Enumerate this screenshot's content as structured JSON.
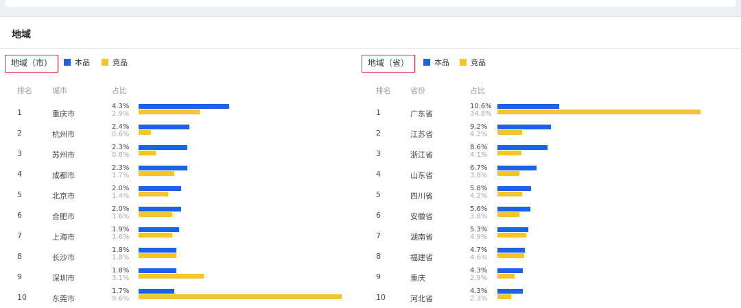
{
  "section_title": "地域",
  "colors": {
    "self": "#1a62e8",
    "comp": "#f5c623",
    "highlight_border": "#e02020"
  },
  "legend": {
    "self": "本品",
    "comp": "竞品"
  },
  "panels": {
    "city": {
      "dim_label": "地域（市）",
      "headers": {
        "rank": "排名",
        "name": "城市",
        "share": "占比"
      },
      "rows": [
        {
          "rank": "1",
          "name": "重庆市",
          "self_pct": "4.3%",
          "comp_pct": "2.9%",
          "self": 4.3,
          "comp": 2.9
        },
        {
          "rank": "2",
          "name": "杭州市",
          "self_pct": "2.4%",
          "comp_pct": "0.6%",
          "self": 2.4,
          "comp": 0.6
        },
        {
          "rank": "3",
          "name": "苏州市",
          "self_pct": "2.3%",
          "comp_pct": "0.8%",
          "self": 2.3,
          "comp": 0.8
        },
        {
          "rank": "4",
          "name": "成都市",
          "self_pct": "2.3%",
          "comp_pct": "1.7%",
          "self": 2.3,
          "comp": 1.7
        },
        {
          "rank": "5",
          "name": "北京市",
          "self_pct": "2.0%",
          "comp_pct": "1.4%",
          "self": 2.0,
          "comp": 1.4
        },
        {
          "rank": "6",
          "name": "合肥市",
          "self_pct": "2.0%",
          "comp_pct": "1.6%",
          "self": 2.0,
          "comp": 1.6
        },
        {
          "rank": "7",
          "name": "上海市",
          "self_pct": "1.9%",
          "comp_pct": "1.6%",
          "self": 1.9,
          "comp": 1.6
        },
        {
          "rank": "8",
          "name": "长沙市",
          "self_pct": "1.8%",
          "comp_pct": "1.8%",
          "self": 1.8,
          "comp": 1.8
        },
        {
          "rank": "9",
          "name": "深圳市",
          "self_pct": "1.8%",
          "comp_pct": "3.1%",
          "self": 1.8,
          "comp": 3.1
        },
        {
          "rank": "10",
          "name": "东莞市",
          "self_pct": "1.7%",
          "comp_pct": "9.6%",
          "self": 1.7,
          "comp": 9.6
        }
      ]
    },
    "province": {
      "dim_label": "地域（省）",
      "headers": {
        "rank": "排名",
        "name": "省份",
        "share": "占比"
      },
      "rows": [
        {
          "rank": "1",
          "name": "广东省",
          "self_pct": "10.6%",
          "comp_pct": "34.8%",
          "self": 10.6,
          "comp": 34.8
        },
        {
          "rank": "2",
          "name": "江苏省",
          "self_pct": "9.2%",
          "comp_pct": "4.2%",
          "self": 9.2,
          "comp": 4.2
        },
        {
          "rank": "3",
          "name": "浙江省",
          "self_pct": "8.6%",
          "comp_pct": "4.1%",
          "self": 8.6,
          "comp": 4.1
        },
        {
          "rank": "4",
          "name": "山东省",
          "self_pct": "6.7%",
          "comp_pct": "3.8%",
          "self": 6.7,
          "comp": 3.8
        },
        {
          "rank": "5",
          "name": "四川省",
          "self_pct": "5.8%",
          "comp_pct": "4.2%",
          "self": 5.8,
          "comp": 4.2
        },
        {
          "rank": "6",
          "name": "安徽省",
          "self_pct": "5.6%",
          "comp_pct": "3.8%",
          "self": 5.6,
          "comp": 3.8
        },
        {
          "rank": "7",
          "name": "湖南省",
          "self_pct": "5.3%",
          "comp_pct": "4.9%",
          "self": 5.3,
          "comp": 4.9
        },
        {
          "rank": "8",
          "name": "福建省",
          "self_pct": "4.7%",
          "comp_pct": "4.6%",
          "self": 4.7,
          "comp": 4.6
        },
        {
          "rank": "9",
          "name": "重庆",
          "self_pct": "4.3%",
          "comp_pct": "2.9%",
          "self": 4.3,
          "comp": 2.9
        },
        {
          "rank": "10",
          "name": "河北省",
          "self_pct": "4.3%",
          "comp_pct": "2.3%",
          "self": 4.3,
          "comp": 2.3
        }
      ]
    }
  }
}
